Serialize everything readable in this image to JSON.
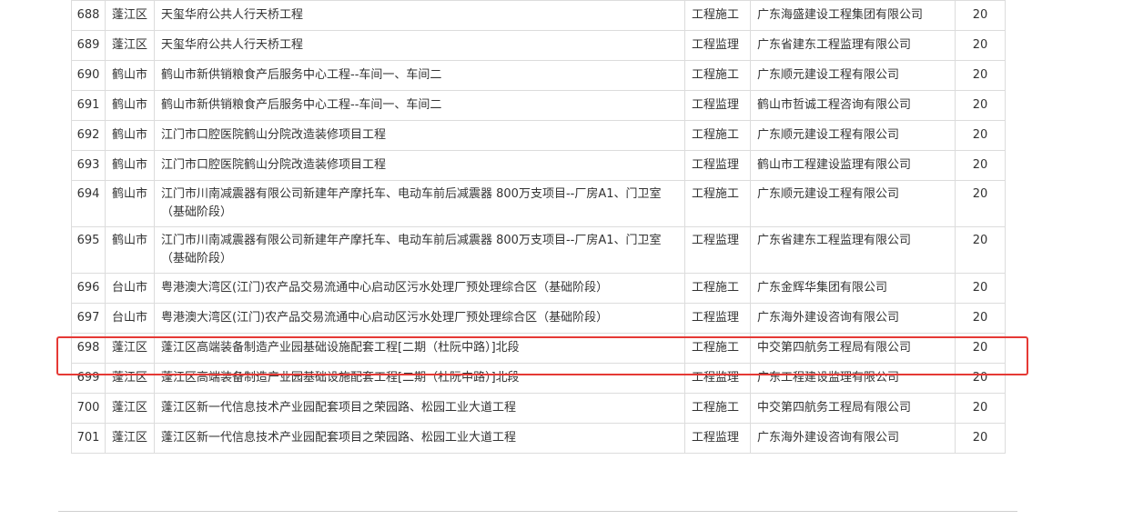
{
  "table": {
    "rows": [
      {
        "no": "688",
        "area": "蓬江区",
        "project": "天玺华府公共人行天桥工程",
        "type": "工程施工",
        "company": "广东海盛建设工程集团有限公司",
        "score": "20"
      },
      {
        "no": "689",
        "area": "蓬江区",
        "project": "天玺华府公共人行天桥工程",
        "type": "工程监理",
        "company": "广东省建东工程监理有限公司",
        "score": "20"
      },
      {
        "no": "690",
        "area": "鹤山市",
        "project": "鹤山市新供销粮食产后服务中心工程--车间一、车间二",
        "type": "工程施工",
        "company": "广东顺元建设工程有限公司",
        "score": "20"
      },
      {
        "no": "691",
        "area": "鹤山市",
        "project": "鹤山市新供销粮食产后服务中心工程--车间一、车间二",
        "type": "工程监理",
        "company": "鹤山市哲诚工程咨询有限公司",
        "score": "20"
      },
      {
        "no": "692",
        "area": "鹤山市",
        "project": "江门市口腔医院鹤山分院改造装修项目工程",
        "type": "工程施工",
        "company": "广东顺元建设工程有限公司",
        "score": "20"
      },
      {
        "no": "693",
        "area": "鹤山市",
        "project": "江门市口腔医院鹤山分院改造装修项目工程",
        "type": "工程监理",
        "company": "鹤山市工程建设监理有限公司",
        "score": "20"
      },
      {
        "no": "694",
        "area": "鹤山市",
        "project": "江门市川南减震器有限公司新建年产摩托车、电动车前后减震器 800万支项目--厂房A1、门卫室（基础阶段）",
        "type": "工程施工",
        "company": "广东顺元建设工程有限公司",
        "score": "20"
      },
      {
        "no": "695",
        "area": "鹤山市",
        "project": "江门市川南减震器有限公司新建年产摩托车、电动车前后减震器 800万支项目--厂房A1、门卫室（基础阶段）",
        "type": "工程监理",
        "company": "广东省建东工程监理有限公司",
        "score": "20"
      },
      {
        "no": "696",
        "area": "台山市",
        "project": "粤港澳大湾区(江门)农产品交易流通中心启动区污水处理厂预处理综合区（基础阶段）",
        "type": "工程施工",
        "company": "广东金辉华集团有限公司",
        "score": "20"
      },
      {
        "no": "697",
        "area": "台山市",
        "project": "粤港澳大湾区(江门)农产品交易流通中心启动区污水处理厂预处理综合区（基础阶段）",
        "type": "工程监理",
        "company": "广东海外建设咨询有限公司",
        "score": "20"
      },
      {
        "no": "698",
        "area": "蓬江区",
        "project": "蓬江区高端装备制造产业园基础设施配套工程[二期（杜阮中路）]北段",
        "type": "工程施工",
        "company": "中交第四航务工程局有限公司",
        "score": "20"
      },
      {
        "no": "699",
        "area": "蓬江区",
        "project": "蓬江区高端装备制造产业园基础设施配套工程[二期（杜阮中路）]北段",
        "type": "工程监理",
        "company": "广东工程建设监理有限公司",
        "score": "20"
      },
      {
        "no": "700",
        "area": "蓬江区",
        "project": "蓬江区新一代信息技术产业园配套项目之荣园路、松园工业大道工程",
        "type": "工程施工",
        "company": "中交第四航务工程局有限公司",
        "score": "20"
      },
      {
        "no": "701",
        "area": "蓬江区",
        "project": "蓬江区新一代信息技术产业园配套项目之荣园路、松园工业大道工程",
        "type": "工程监理",
        "company": "广东海外建设咨询有限公司",
        "score": "20"
      }
    ]
  },
  "highlight": {
    "color": "#e53935",
    "row_no": "698"
  }
}
